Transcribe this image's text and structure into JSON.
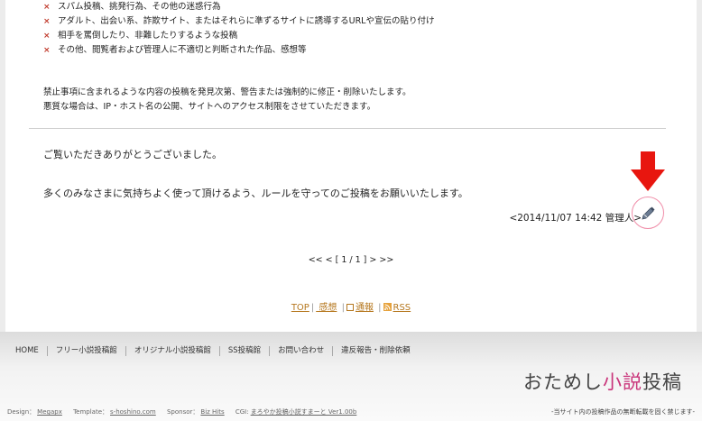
{
  "rules": [
    {
      "mark": "×",
      "text": "スパム投稿、挑発行為、その他の迷惑行為"
    },
    {
      "mark": "×",
      "text": "アダルト、出会い系、詐欺サイト、またはそれらに準ずるサイトに誘導するURLや宣伝の貼り付け"
    },
    {
      "mark": "×",
      "text": "相手を罵倒したり、非難したりするような投稿"
    },
    {
      "mark": "×",
      "text": "その他、閲覧者および管理人に不適切と判断された作品、感想等"
    }
  ],
  "notice": {
    "line1": "禁止事項に含まれるような内容の投稿を発見次第、警告または強制的に修正・削除いたします。",
    "line2": "悪質な場合は、IP・ホスト名の公開、サイトへのアクセス制限をさせていただきます。"
  },
  "message": {
    "thanks": "ご覧いただきありがとうございました。",
    "request": "多くのみなさまに気持ちよく使って頂けるよう、ルールを守ってのご投稿をお願いいたします。",
    "stamp": "<2014/11/07 14:42 管理人>"
  },
  "pager": "<< < [ 1 / 1 ] > >>",
  "links": {
    "top": "TOP",
    "sep": "|",
    "kansou": " 感想",
    "tsuho": "通報",
    "rss": "RSS"
  },
  "footer": {
    "nav": [
      "HOME",
      "フリー小説投稿館",
      "オリジナル小説投稿館",
      "SS投稿館",
      "お問い合わせ",
      "違反報告・削除依頼"
    ],
    "title_a": "おためし",
    "title_b": "小説",
    "title_c": "投稿",
    "tagline": "-当サイト内の投稿作品の無断転載を固く禁じます-",
    "credits": {
      "design_label": "Design：",
      "design_value": "Megapx",
      "template_label": "Template：",
      "template_value": "s-hoshino.com",
      "sponsor_label": "Sponsor：",
      "sponsor_value": "Biz Hits",
      "cgi_label": "CGI:",
      "cgi_value": "まろやか投稿小説すまーと Ver1.00b"
    }
  },
  "colors": {
    "mark": "#c0392b",
    "link": "#b5771e",
    "accent": "#c9347a",
    "arrow": "#e8160f",
    "highlight": "#f08ca8"
  },
  "icons": {
    "edit": "pencil-icon",
    "arrow": "arrow-down-icon",
    "tsuho": "square-icon",
    "rss": "rss-icon"
  }
}
